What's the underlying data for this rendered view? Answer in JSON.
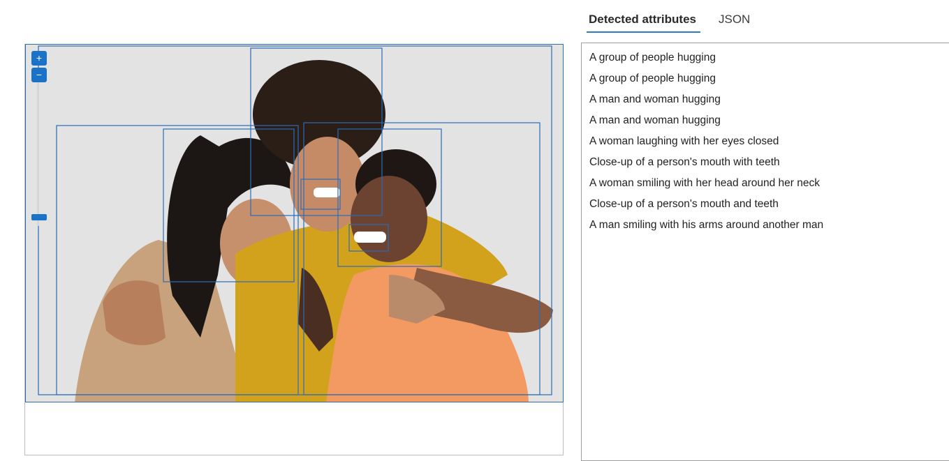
{
  "tabs": {
    "detected": "Detected attributes",
    "json": "JSON"
  },
  "attributes": [
    "A group of people hugging",
    "A group of people hugging",
    "A man and woman hugging",
    "A man and woman hugging",
    "A woman laughing with her eyes closed",
    "Close-up of a person's mouth with teeth",
    "A woman smiling with her head around her neck",
    "Close-up of a person's mouth and teeth",
    "A man smiling with his arms around another man"
  ],
  "zoom": {
    "in_icon": "plus-icon",
    "out_icon": "minus-icon",
    "level": 0
  },
  "colors": {
    "accent": "#1a73c8",
    "box_outline": "#2b6cb6",
    "tab_underline": "#2a7bbd"
  }
}
